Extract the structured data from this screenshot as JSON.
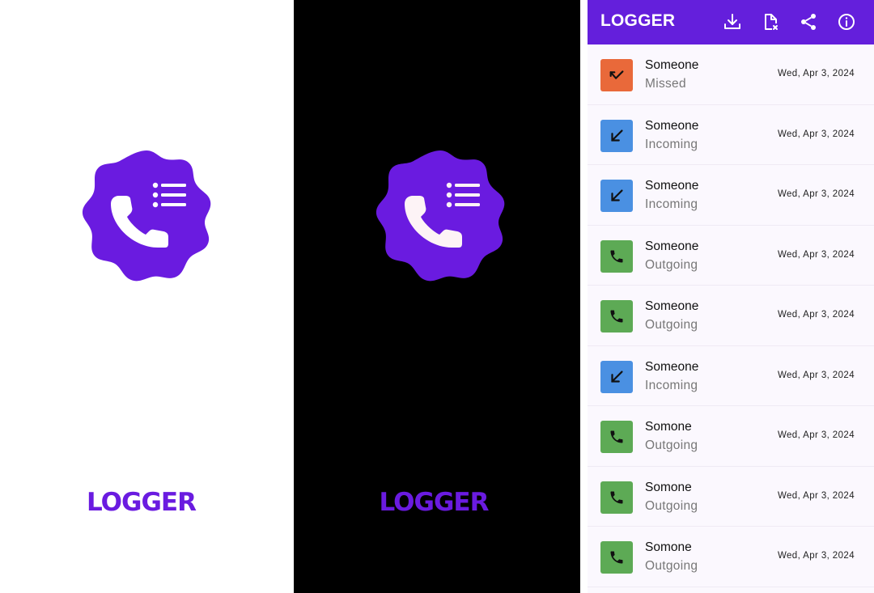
{
  "colors": {
    "brand_purple": "#6a1be0",
    "appbar_purple": "#641fdc",
    "missed": "#e9693a",
    "incoming": "#4a90e2",
    "outgoing": "#5daa55",
    "splash_dark_bg": "#000000",
    "list_bg": "#fbf8fe"
  },
  "splash_light": {
    "logo_icon": "phone-list-badge-icon",
    "wordmark": "LOGGER"
  },
  "splash_dark": {
    "logo_icon": "phone-list-badge-icon",
    "wordmark": "LOGGER"
  },
  "appbar": {
    "title": "LOGGER",
    "actions": [
      {
        "name": "download-icon"
      },
      {
        "name": "export-file-icon"
      },
      {
        "name": "share-icon"
      },
      {
        "name": "info-icon"
      }
    ]
  },
  "calls": [
    {
      "name": "Someone",
      "type": "Missed",
      "date": "Wed, Apr 3, 2024",
      "icon": "missed-call-icon"
    },
    {
      "name": "Someone",
      "type": "Incoming",
      "date": "Wed, Apr 3, 2024",
      "icon": "incoming-call-icon"
    },
    {
      "name": "Someone",
      "type": "Incoming",
      "date": "Wed, Apr 3, 2024",
      "icon": "incoming-call-icon"
    },
    {
      "name": "Someone",
      "type": "Outgoing",
      "date": "Wed, Apr 3, 2024",
      "icon": "phone-icon"
    },
    {
      "name": "Someone",
      "type": "Outgoing",
      "date": "Wed, Apr 3, 2024",
      "icon": "phone-icon"
    },
    {
      "name": "Someone",
      "type": "Incoming",
      "date": "Wed, Apr 3, 2024",
      "icon": "incoming-call-icon"
    },
    {
      "name": "Somone",
      "type": "Outgoing",
      "date": "Wed, Apr 3, 2024",
      "icon": "phone-icon"
    },
    {
      "name": "Somone",
      "type": "Outgoing",
      "date": "Wed, Apr 3, 2024",
      "icon": "phone-icon"
    },
    {
      "name": "Somone",
      "type": "Outgoing",
      "date": "Wed, Apr 3, 2024",
      "icon": "phone-icon"
    }
  ]
}
